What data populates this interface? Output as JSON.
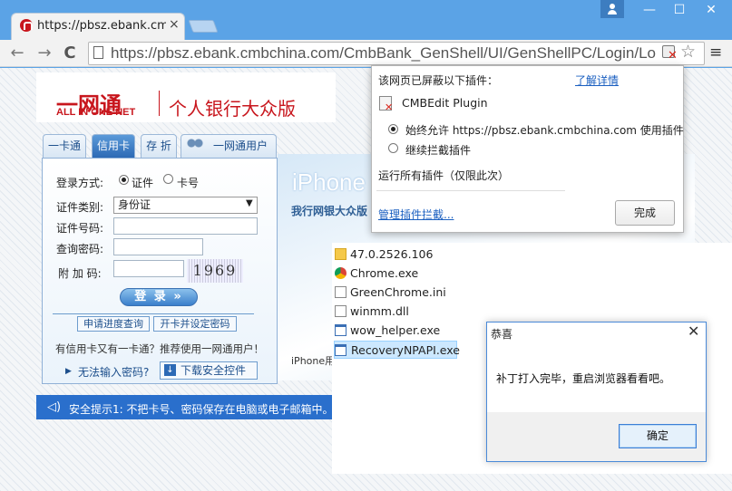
{
  "browser": {
    "tab_title": "https://pbsz.ebank.cmbc",
    "tab_close": "×",
    "window_controls": {
      "minimize": "—",
      "maximize": "☐",
      "close": "✕"
    },
    "back": "←",
    "forward": "→",
    "reload": "C",
    "url": "https://pbsz.ebank.cmbchina.com/CmbBank_GenShell/UI/GenShellPC/Login/Lo",
    "star": "☆",
    "menu": "≡",
    "plugin_blocked_icon": "plugin-blocked-icon"
  },
  "plugin_popup": {
    "header": "该网页已屏蔽以下插件：",
    "learn_more": "了解详情",
    "plugin_name": "CMBEdit Plugin",
    "options": [
      {
        "label": "始终允许 https://pbsz.ebank.cmbchina.com 使用插件",
        "selected": true
      },
      {
        "label": "继续拦截插件",
        "selected": false
      }
    ],
    "run_all": "运行所有插件（仅限此次）",
    "manage": "管理插件拦截...",
    "done": "完成"
  },
  "bank": {
    "logo_cn": "一网通",
    "logo_en": "ALL IN ONE NET",
    "subtitle": "个人银行大众版",
    "tabs": [
      {
        "label": "一卡通",
        "active": false
      },
      {
        "label": "信用卡",
        "active": true
      },
      {
        "label": "存 折",
        "active": false
      },
      {
        "label": "一网通用户",
        "active": false
      }
    ],
    "login": {
      "method_label": "登录方式:",
      "method_options": [
        {
          "label": "证件",
          "selected": true
        },
        {
          "label": "卡号",
          "selected": false
        }
      ],
      "idtype_label": "证件类别:",
      "idtype_value": "身份证",
      "idnum_label": "证件号码:",
      "password_label": "查询密码:",
      "code_label": "附 加 码:",
      "captcha": "1969",
      "login_button": "登 录 »",
      "progress_link": "申请进度查询",
      "activate_link": "开卡并设定密码",
      "promo": "有信用卡又有一卡通？推荐使用一网通用户！",
      "noinput_link": "无法输入密码?",
      "download_button": "下载安全控件"
    },
    "banner": {
      "title": "iPhone",
      "subtitle": "我行网银大众版",
      "footer": "iPhone用"
    },
    "notice": "安全提示1: 不把卡号、密码保存在电脑或电子邮箱中。"
  },
  "explorer": {
    "files": [
      {
        "name": "47.0.2526.106",
        "icon": "folder-icon",
        "selected": false
      },
      {
        "name": "Chrome.exe",
        "icon": "chrome-icon",
        "selected": false
      },
      {
        "name": "GreenChrome.ini",
        "icon": "ini-file-icon",
        "selected": false
      },
      {
        "name": "winmm.dll",
        "icon": "dll-file-icon",
        "selected": false
      },
      {
        "name": "wow_helper.exe",
        "icon": "exe-file-icon",
        "selected": false
      },
      {
        "name": "RecoveryNPAPI.exe",
        "icon": "exe-file-icon",
        "selected": true
      }
    ]
  },
  "dialog": {
    "title": "恭喜",
    "close": "✕",
    "message": "补丁打入完毕，重启浏览器看看吧。",
    "ok": "确定"
  },
  "colors": {
    "titlebar": "#5ba3e6",
    "bank_red": "#c8161d",
    "link_blue": "#1a5fc0",
    "notice_blue": "#2a6fcc"
  }
}
